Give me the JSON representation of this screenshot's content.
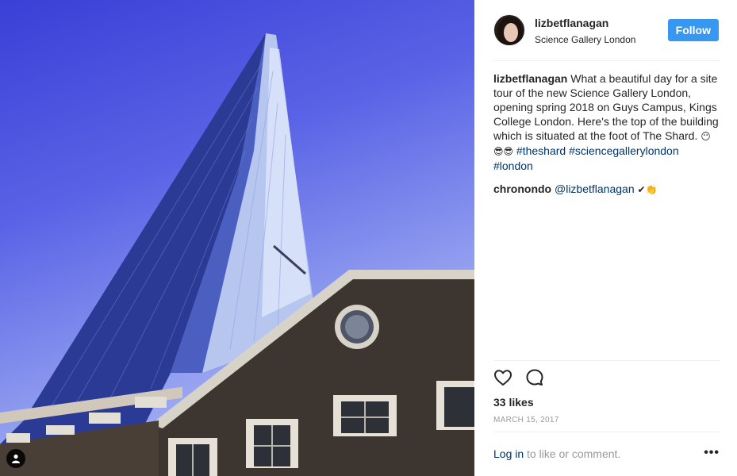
{
  "post": {
    "username": "lizbetflanagan",
    "location": "Science Gallery London",
    "follow_label": "Follow",
    "caption_author": "lizbetflanagan",
    "caption_text": "What a beautiful day for a site tour of the new Science Gallery London, opening spring 2018 on Guys Campus, Kings College London. Here's the top of the building which is situated at the foot of The Shard.",
    "caption_emojis": "😶😎😎",
    "hashtags": [
      "#theshard",
      "#sciencegallerylondon",
      "#london"
    ],
    "comment_author": "chronondo",
    "comment_mention": "@lizbetflanagan",
    "comment_emojis": "✔👏",
    "likes": "33 likes",
    "date": "MARCH 15, 2017",
    "login_link": "Log in",
    "login_rest": "to like or comment.",
    "more_label": "•••"
  },
  "icons": {
    "heart": "heart-icon",
    "comment": "comment-icon",
    "user_tag": "user-tag-icon",
    "more": "more-options-icon"
  },
  "colors": {
    "follow_button": "#3897f0",
    "link": "#003569",
    "muted": "#999999"
  }
}
